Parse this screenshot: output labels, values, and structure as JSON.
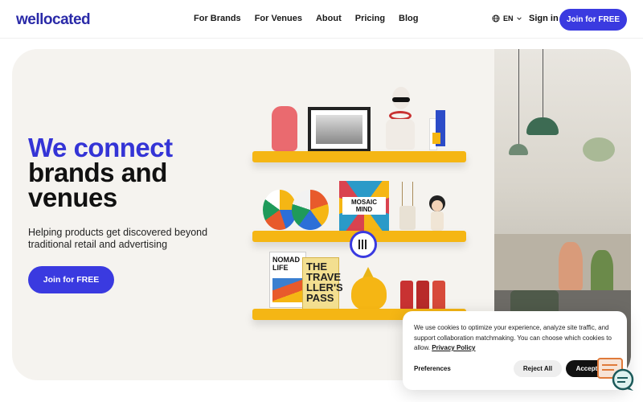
{
  "header": {
    "logo": "wellocated",
    "nav": [
      "For Brands",
      "For Venues",
      "About",
      "Pricing",
      "Blog"
    ],
    "language": "EN",
    "sign_in": "Sign in",
    "cta": "Join for FREE"
  },
  "hero": {
    "headline_line1": "We connect",
    "headline_line2": "brands and",
    "headline_line3": "venues",
    "subtitle": "Helping products get discovered beyond traditional retail and advertising",
    "cta": "Join for FREE",
    "book1_title": "NOMAD LIFE",
    "book2_title": "THE TRAVE LLER'S PASS",
    "box_title": "MOSAIC MIND"
  },
  "cookie": {
    "text": "We use cookies to optimize your experience, analyze site traffic, and support collaboration matchmaking. You can choose which cookies to allow.",
    "privacy_link": "Privacy Policy",
    "preferences": "Preferences",
    "reject": "Reject All",
    "accept": "Accept All"
  },
  "colors": {
    "brand": "#3a3ae0",
    "headline_blue": "#3434d6",
    "shelf": "#f5b614"
  }
}
